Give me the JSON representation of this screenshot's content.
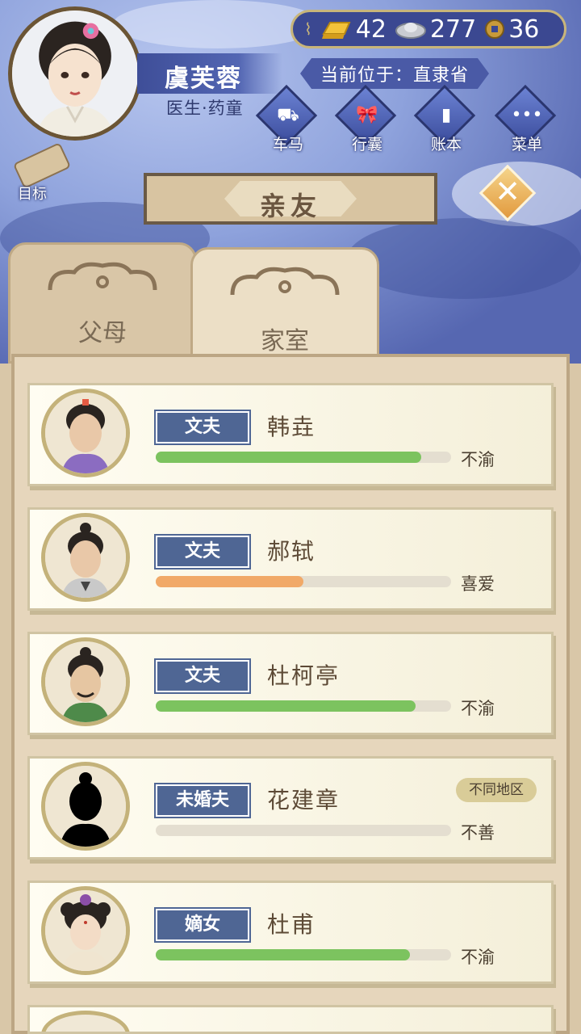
{
  "player": {
    "name": "虞芙蓉",
    "title": "医生·药童",
    "location": "当前位于：直隶省"
  },
  "currency": [
    {
      "icon": "gold-ingot-icon",
      "value": "42"
    },
    {
      "icon": "silver-ingot-icon",
      "value": "277"
    },
    {
      "icon": "copper-coin-icon",
      "value": "36"
    }
  ],
  "menu": [
    {
      "icon": "carriage-icon",
      "label": "车马"
    },
    {
      "icon": "bag-icon",
      "label": "行囊"
    },
    {
      "icon": "ledger-icon",
      "label": "账本"
    },
    {
      "icon": "more-icon",
      "label": "菜单"
    }
  ],
  "goal_label": "目标",
  "panel_title": "亲友",
  "tabs": [
    {
      "label": "父母",
      "active": false
    },
    {
      "label": "家室",
      "active": true
    }
  ],
  "relatives": [
    {
      "role": "文夫",
      "name": "韩垚",
      "mood": "不渝",
      "affection": 0.9,
      "bar_color": "#7cc35f"
    },
    {
      "role": "文夫",
      "name": "郝轼",
      "mood": "喜爱",
      "affection": 0.5,
      "bar_color": "#f1a968"
    },
    {
      "role": "文夫",
      "name": "杜柯亭",
      "mood": "不渝",
      "affection": 0.88,
      "bar_color": "#7cc35f"
    },
    {
      "role": "未婚夫",
      "name": "花建章",
      "mood": "不善",
      "affection": 0.0,
      "bar_color": "#7cc35f",
      "region": "不同地区"
    },
    {
      "role": "嫡女",
      "name": "杜甫",
      "mood": "不渝",
      "affection": 0.86,
      "bar_color": "#7cc35f"
    }
  ],
  "colors": {
    "role_tag": "#4f6694",
    "sky": "#5b6fb8",
    "panel": "#e6d6bc"
  }
}
